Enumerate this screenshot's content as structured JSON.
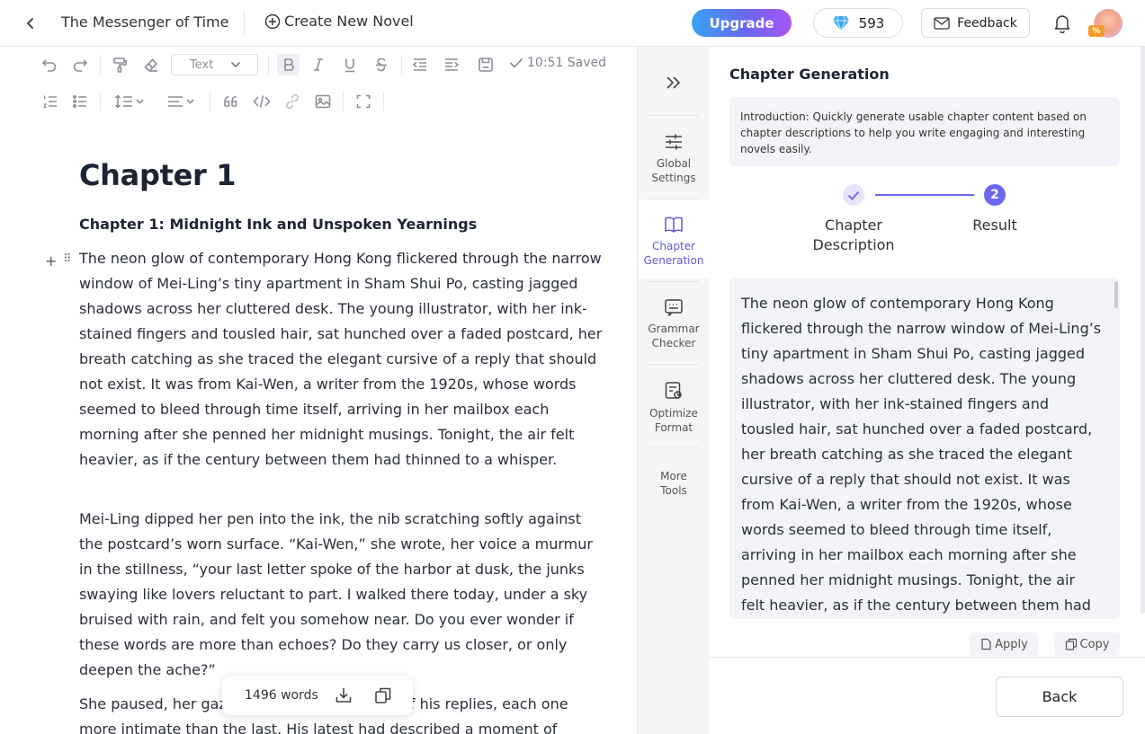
{
  "header": {
    "novel_title": "The Messenger of Time",
    "create_label": "Create New Novel",
    "upgrade_label": "Upgrade",
    "credits": "593",
    "feedback_label": "Feedback",
    "avatar_badge": "%"
  },
  "toolbar": {
    "text_style": "Text",
    "saved_status": "10:51 Saved"
  },
  "editor": {
    "chapter_heading": "Chapter 1",
    "chapter_subtitle": "Chapter 1: Midnight Ink and Unspoken Yearnings",
    "paragraphs": [
      "The neon glow of contemporary Hong Kong flickered through the narrow window of Mei-Ling’s tiny apartment in Sham Shui Po, casting jagged shadows across her cluttered desk. The young illustrator, with her ink-stained fingers and tousled hair, sat hunched over a faded postcard, her breath catching as she traced the elegant cursive of a reply that should not exist. It was from Kai-Wen, a writer from the 1920s, whose words seemed to bleed through time itself, arriving in her mailbox each morning after she penned her midnight musings. Tonight, the air felt heavier, as if the century between them had thinned to a whisper.",
      "Mei-Ling dipped her pen into the ink, the nib scratching softly against the postcard’s worn surface. “Kai-Wen,” she wrote, her voice a murmur in the stillness, “your last letter spoke of the harbor at dusk, the junks swaying like lovers reluctant to part. I walked there today, under a sky bruised with rain, and felt you somehow near. Do you ever wonder if these words are more than echoes? Do they carry us closer, or only deepen the ache?”",
      "She paused, her gaze lingering on the stack of his replies, each one more intimate than the last. His latest had described a moment of solitude in"
    ],
    "word_count": "1496 words"
  },
  "rail": {
    "items": [
      {
        "label": "Global Settings",
        "icon": "sliders-icon"
      },
      {
        "label": "Chapter Generation",
        "icon": "open-book-icon"
      },
      {
        "label": "Grammar Checker",
        "icon": "grammar-check-icon"
      },
      {
        "label": "Optimize Format",
        "icon": "format-optimize-icon"
      },
      {
        "label": "More Tools",
        "icon": ""
      }
    ]
  },
  "panel": {
    "title": "Chapter Generation",
    "intro": "Introduction: Quickly generate usable chapter content based on chapter descriptions to help you write engaging and interesting novels easily.",
    "steps": [
      {
        "label": "Chapter Description",
        "status": "done"
      },
      {
        "label": "Result",
        "number": "2",
        "status": "current"
      }
    ],
    "result_text": "The neon glow of contemporary Hong Kong flickered through the narrow window of Mei-Ling’s tiny apartment in Sham Shui Po, casting jagged shadows across her cluttered desk. The young illustrator, with her ink-stained fingers and tousled hair, sat hunched over a faded postcard, her breath catching as she traced the elegant cursive of a reply that should not exist. It was from Kai-Wen, a writer from the 1920s, whose words seemed to bleed through time itself, arriving in her mailbox each morning after she penned her midnight musings. Tonight, the air felt heavier, as if the century between them had thinned to a whisper.",
    "apply_label": "Apply",
    "copy_label": "Copy",
    "back_label": "Back"
  },
  "colors": {
    "accent": "#6b67f0",
    "upgrade_gradient_start": "#36a3f2",
    "upgrade_gradient_end": "#a855f7"
  }
}
